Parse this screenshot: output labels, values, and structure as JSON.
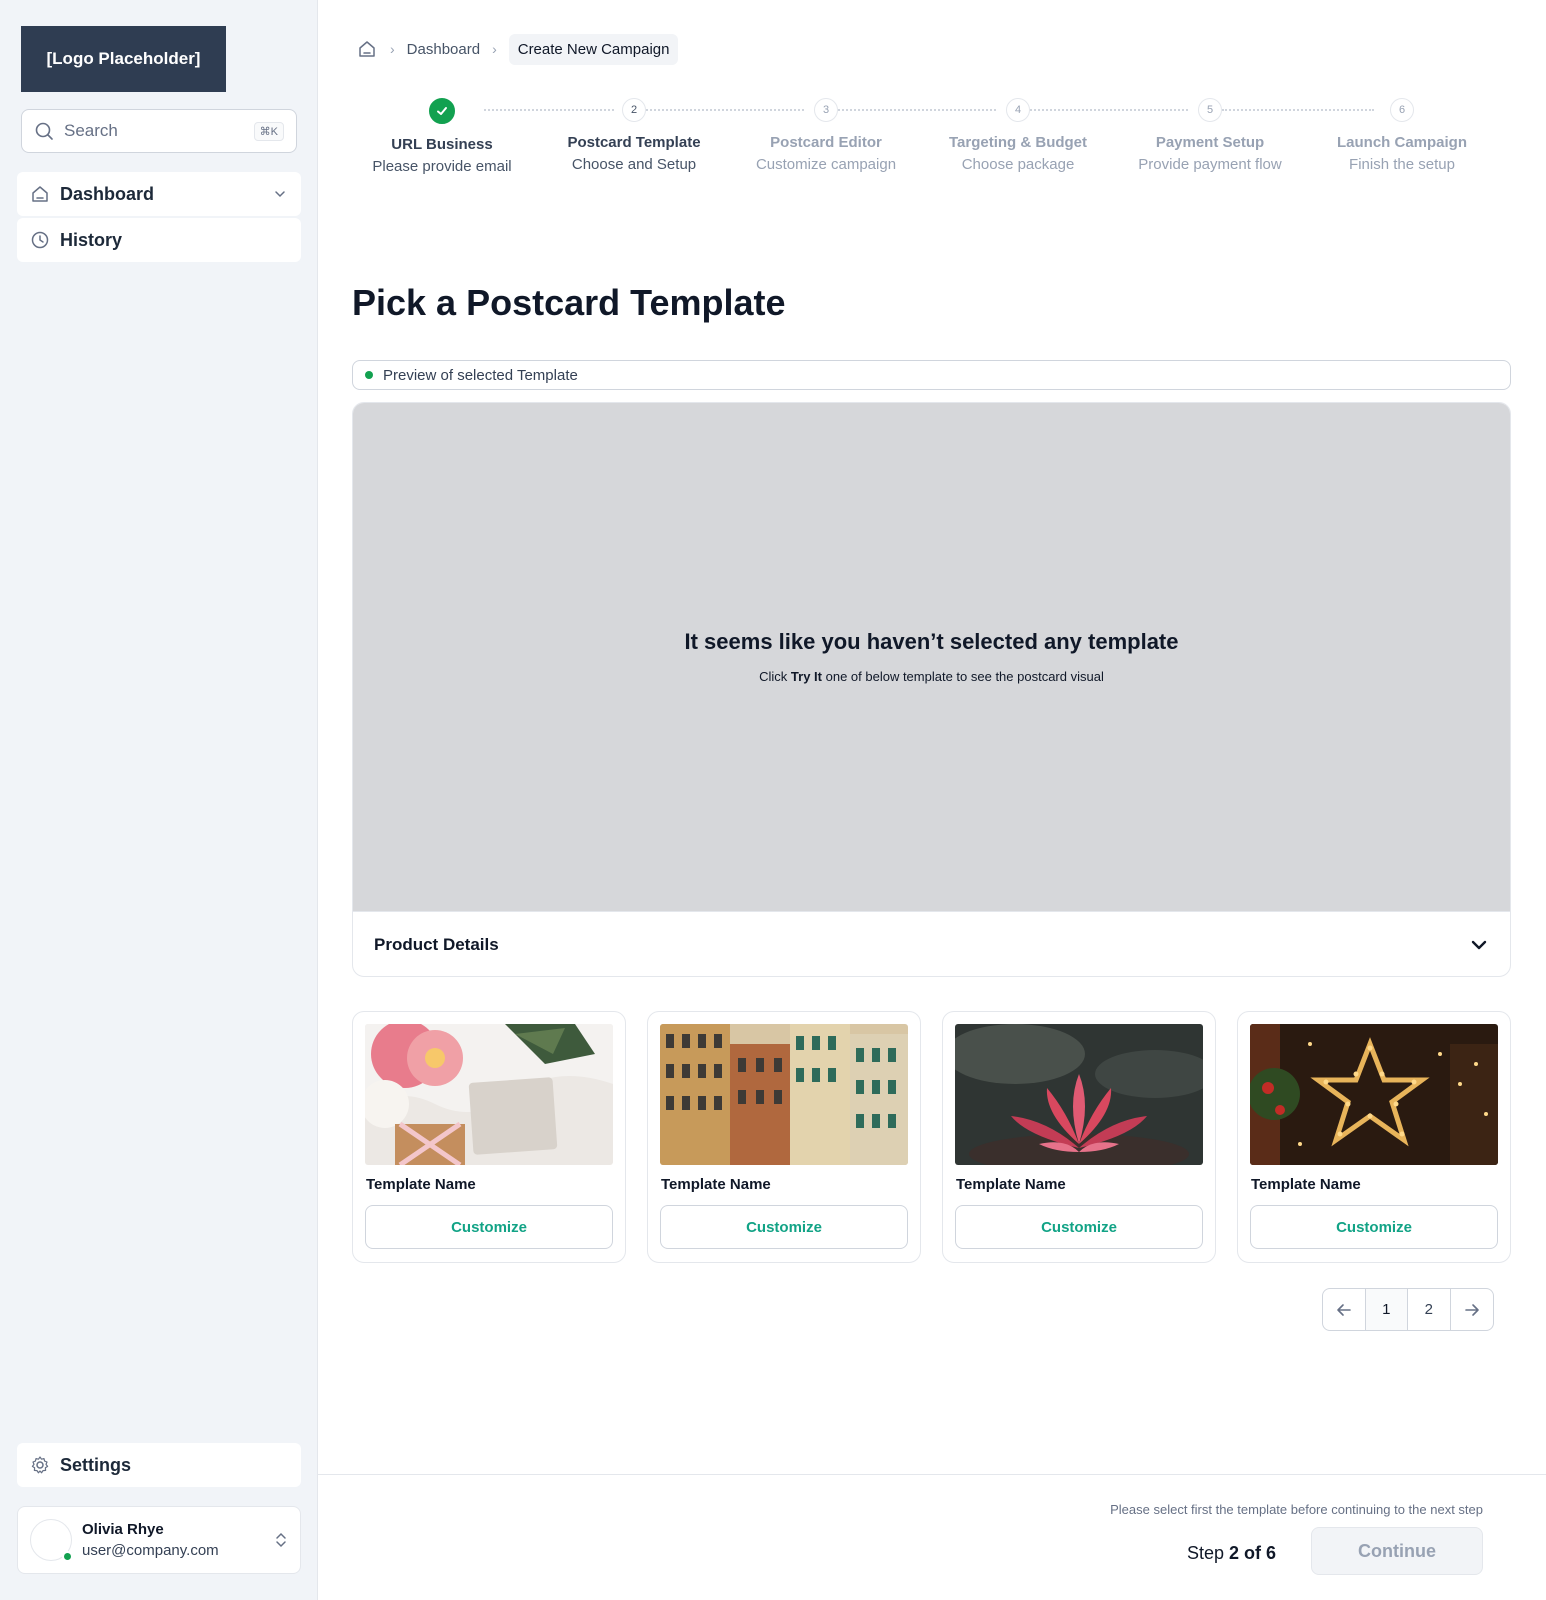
{
  "sidebar": {
    "logo": "[Logo Placeholder]",
    "search": {
      "placeholder": "Search",
      "shortcut": "⌘K"
    },
    "nav": [
      {
        "label": "Dashboard",
        "icon": "home-icon"
      },
      {
        "label": "History",
        "icon": "clock-icon"
      }
    ],
    "settings": {
      "label": "Settings",
      "icon": "gear-icon"
    },
    "user": {
      "name": "Olivia Rhye",
      "email": "user@company.com",
      "status_color": "#12a150"
    }
  },
  "breadcrumb": {
    "items": [
      "Dashboard",
      "Create New Campaign"
    ]
  },
  "steps": [
    {
      "number": "1",
      "title": "URL Business",
      "subtitle": "Please provide email",
      "state": "complete"
    },
    {
      "number": "2",
      "title": "Postcard Template",
      "subtitle": "Choose and Setup",
      "state": "current"
    },
    {
      "number": "3",
      "title": "Postcard Editor",
      "subtitle": "Customize campaign",
      "state": "upcoming"
    },
    {
      "number": "4",
      "title": "Targeting & Budget",
      "subtitle": "Choose package",
      "state": "upcoming"
    },
    {
      "number": "5",
      "title": "Payment Setup",
      "subtitle": "Provide payment flow",
      "state": "upcoming"
    },
    {
      "number": "6",
      "title": "Launch Campaign",
      "subtitle": "Finish the setup",
      "state": "upcoming"
    }
  ],
  "main": {
    "title": "Pick a Postcard Template",
    "preview_label": "Preview of selected Template",
    "empty_heading": "It seems like you haven’t selected any template",
    "empty_sub_prefix": "Click ",
    "empty_sub_bold": "Try It",
    "empty_sub_suffix": " one of below template to see the postcard visual",
    "details_label": "Product Details"
  },
  "templates": [
    {
      "name": "Template Name",
      "button": "Customize",
      "image": "flowers-gift-photo"
    },
    {
      "name": "Template Name",
      "button": "Customize",
      "image": "colorful-buildings-photo"
    },
    {
      "name": "Template Name",
      "button": "Customize",
      "image": "lotus-flower-photo"
    },
    {
      "name": "Template Name",
      "button": "Customize",
      "image": "christmas-lights-photo"
    }
  ],
  "pagination": {
    "pages": [
      "1",
      "2"
    ],
    "current": "1"
  },
  "footer": {
    "note": "Please select first the template before continuing to the next step",
    "step_prefix": "Step ",
    "step_value": "2 of 6",
    "continue_label": "Continue"
  },
  "colors": {
    "accent": "#12a150",
    "customize_text": "#12a386",
    "logo_bg": "#2f3d52"
  }
}
